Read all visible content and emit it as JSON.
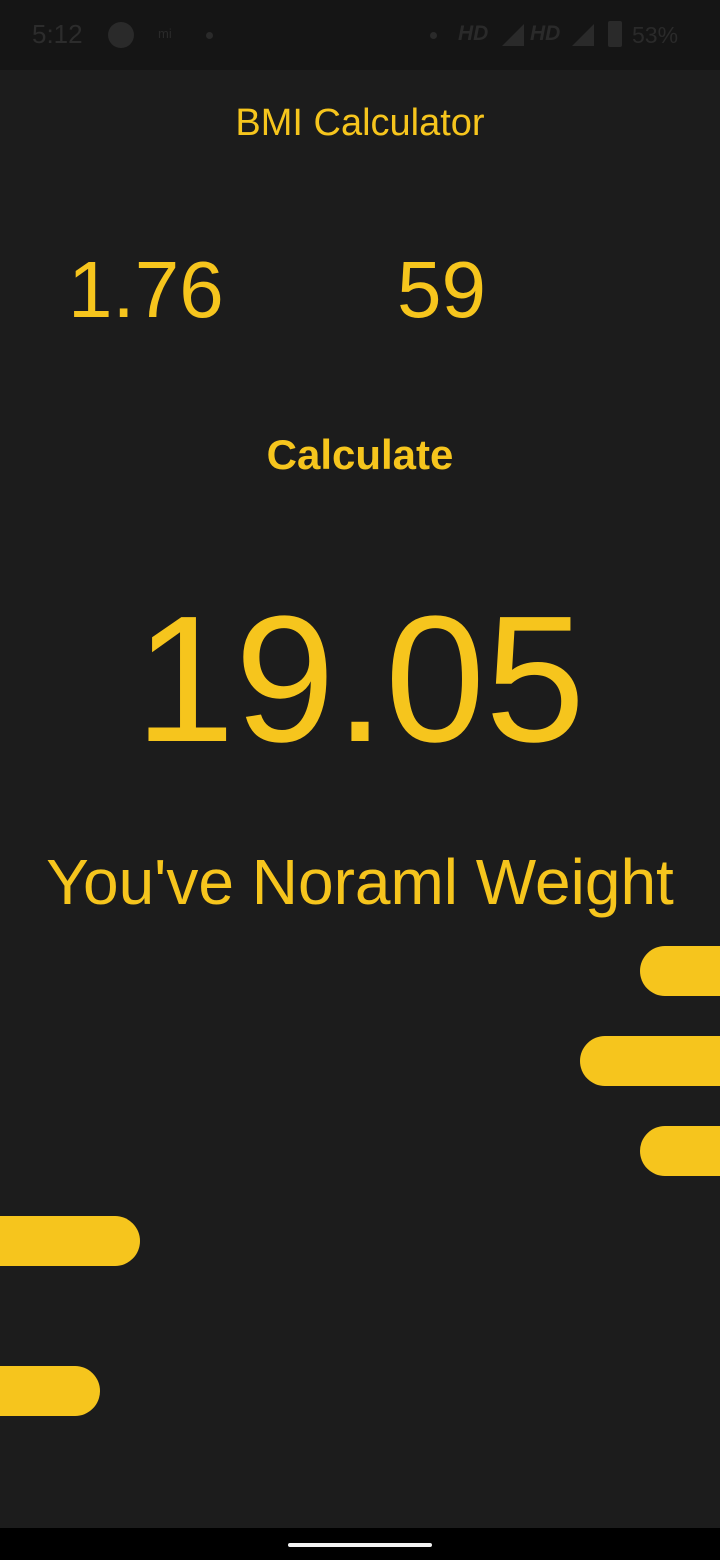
{
  "status_bar": {
    "time": "5:12",
    "mi_label": "mi",
    "hd_1": "HD",
    "hd_2": "HD",
    "battery_percent": "53%"
  },
  "app": {
    "title": "BMI Calculator",
    "height_value": "1.76",
    "weight_value": "59",
    "calculate_label": "Calculate",
    "bmi_result": "19.05",
    "result_message": "You've Noraml Weight"
  },
  "colors": {
    "accent": "#f6c51d",
    "background": "#1c1c1c"
  },
  "icons": [
    "app-icon",
    "signal-icon",
    "battery-icon"
  ]
}
